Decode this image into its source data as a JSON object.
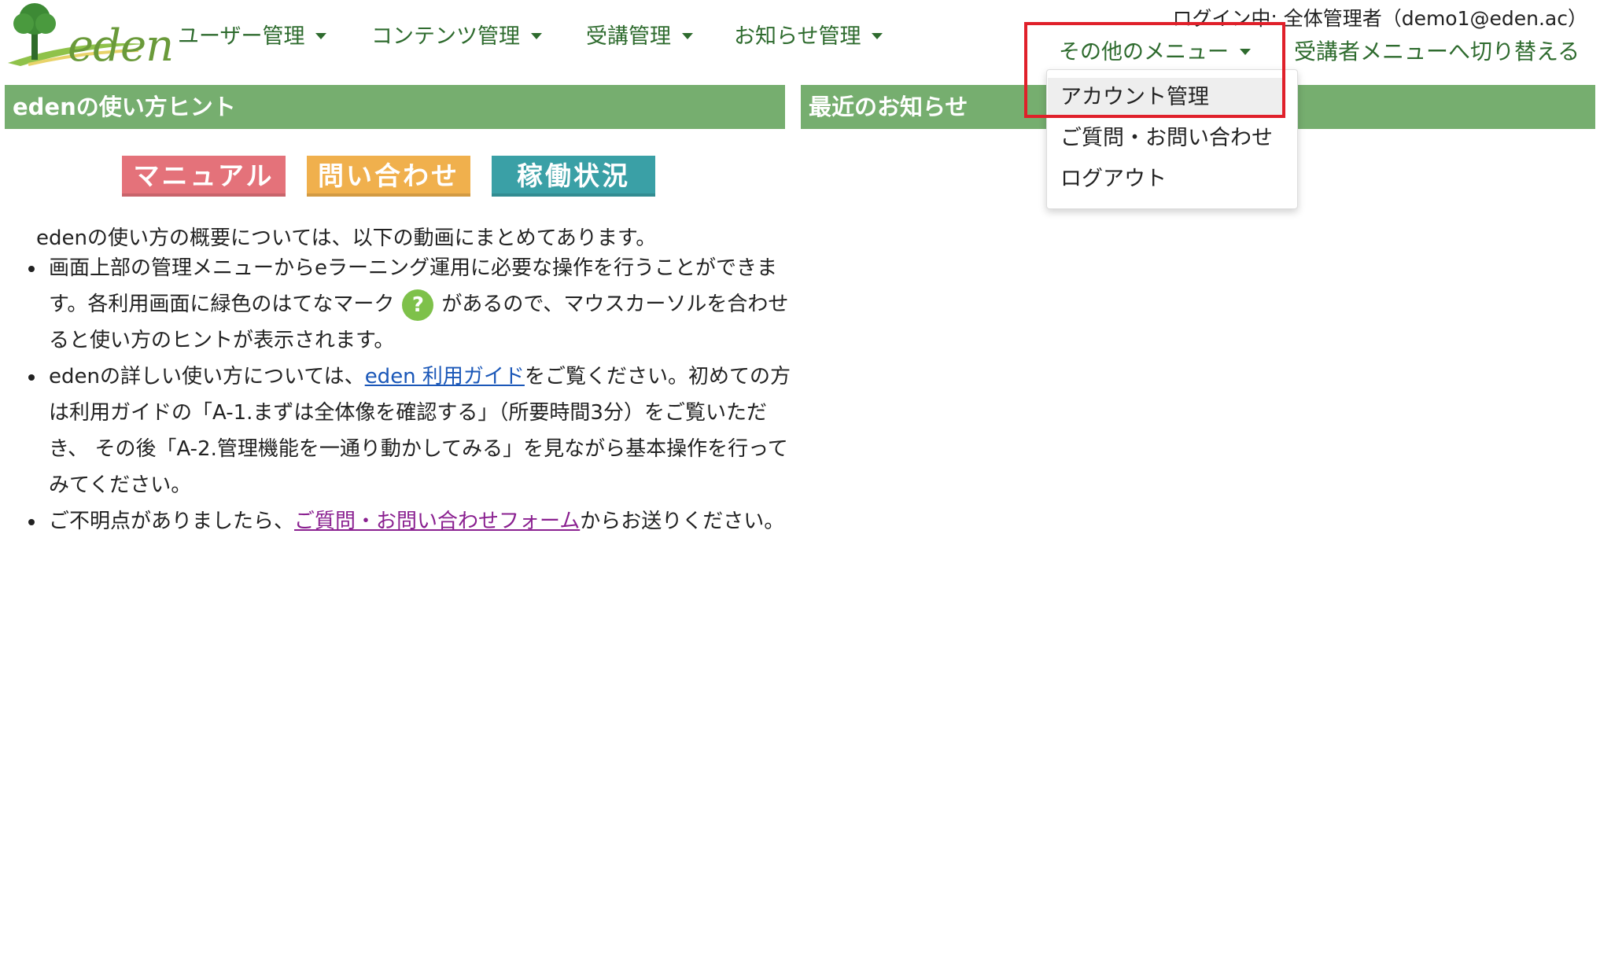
{
  "header": {
    "logo_text": "eden",
    "nav": [
      {
        "label": "ユーザー管理"
      },
      {
        "label": "コンテンツ管理"
      },
      {
        "label": "受講管理"
      },
      {
        "label": "お知らせ管理"
      }
    ],
    "other_menu_label": "その他のメニュー",
    "login_status": "ログイン中: 全体管理者（demo1@eden.ac）",
    "switch_link": "受講者メニューへ切り替える"
  },
  "dropdown": {
    "items": [
      {
        "label": "アカウント管理"
      },
      {
        "label": "ご質問・お問い合わせ"
      },
      {
        "label": "ログアウト"
      }
    ]
  },
  "hint_panel": {
    "title": "edenの使い方ヒント",
    "buttons": {
      "manual": "マニュアル",
      "contact": "問い合わせ",
      "status": "稼働状況"
    },
    "intro": "edenの使い方の概要については、以下の動画にまとめてあります。",
    "item1_part1": "画面上部の管理メニューからeラーニング運用に必要な操作を行うことができます。各利用画面に緑色のはてなマーク",
    "item1_icon": "?",
    "item1_part2": "があるので、マウスカーソルを合わせると使い方のヒントが表示されます。",
    "item2_part1": "edenの詳しい使い方については、",
    "item2_link": "eden 利用ガイド",
    "item2_part2": "をご覧ください。初めての方は利用ガイドの「A-1.まずは全体像を確認する」（所要時間3分）をご覧いただき、 その後「A-2.管理機能を一通り動かしてみる」を見ながら基本操作を行ってみてください。",
    "item3_part1": "ご不明点がありましたら、",
    "item3_link": "ご質問・お問い合わせフォーム",
    "item3_part2": "からお送りください。"
  },
  "news_panel": {
    "title": "最近のお知らせ"
  },
  "colors": {
    "panel_header": "#76ae6f",
    "nav_text": "#2e6b2e",
    "manual_button": "#e4727a",
    "contact_button": "#f0b04d",
    "status_button": "#3aa0a6",
    "highlight": "#e0202a"
  }
}
